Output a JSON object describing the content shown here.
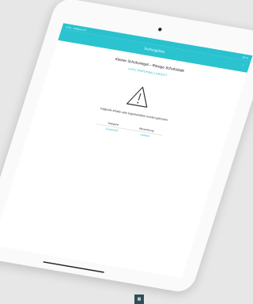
{
  "status": {
    "left": "12:34 · Vodafone CZ",
    "right": "100 %"
  },
  "appbar": {
    "title": "Suchergebnis",
    "menu_icon": "menu-icon"
  },
  "product": {
    "title": "Kleiner Schokoriegel – Riesige Schokolade",
    "category": "CHOC MARSHMALLOWSKIT"
  },
  "warning": {
    "icon": "warning-icon",
    "text": "Folgende Inhalte oder Eigenschaften wurden gefunden"
  },
  "table": {
    "headers": [
      "Kategorie",
      "Bezeichnung"
    ],
    "rows": [
      [
        "Zusatzstoff",
        "Gelatine"
      ]
    ]
  },
  "colors": {
    "accent": "#2bc3d0"
  }
}
